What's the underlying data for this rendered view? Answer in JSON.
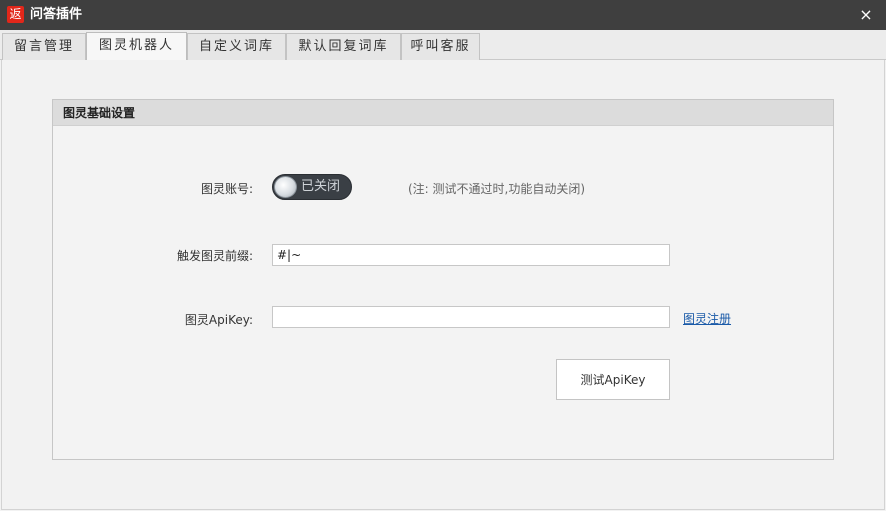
{
  "window": {
    "icon_glyph": "返",
    "title": "问答插件",
    "close_glyph": "×"
  },
  "tabs": [
    {
      "label": "留言管理",
      "active": false
    },
    {
      "label": "图灵机器人",
      "active": true
    },
    {
      "label": "自定义词库",
      "active": false
    },
    {
      "label": "默认回复词库",
      "active": false
    },
    {
      "label": "呼叫客服",
      "active": false
    }
  ],
  "panel": {
    "title": "图灵基础设置",
    "account": {
      "label": "图灵账号:",
      "toggle_text": "已关闭",
      "toggle_on": false,
      "note": "(注: 测试不通过时,功能自动关闭)"
    },
    "prefix": {
      "label": "触发图灵前缀:",
      "value": "#|~"
    },
    "apikey": {
      "label": "图灵ApiKey:",
      "value": "",
      "register_link": "图灵注册"
    },
    "test_button": "测试ApiKey"
  },
  "colors": {
    "titlebar": "#3f3f3f",
    "app_icon": "#e2271a",
    "link": "#1a5aa8"
  }
}
